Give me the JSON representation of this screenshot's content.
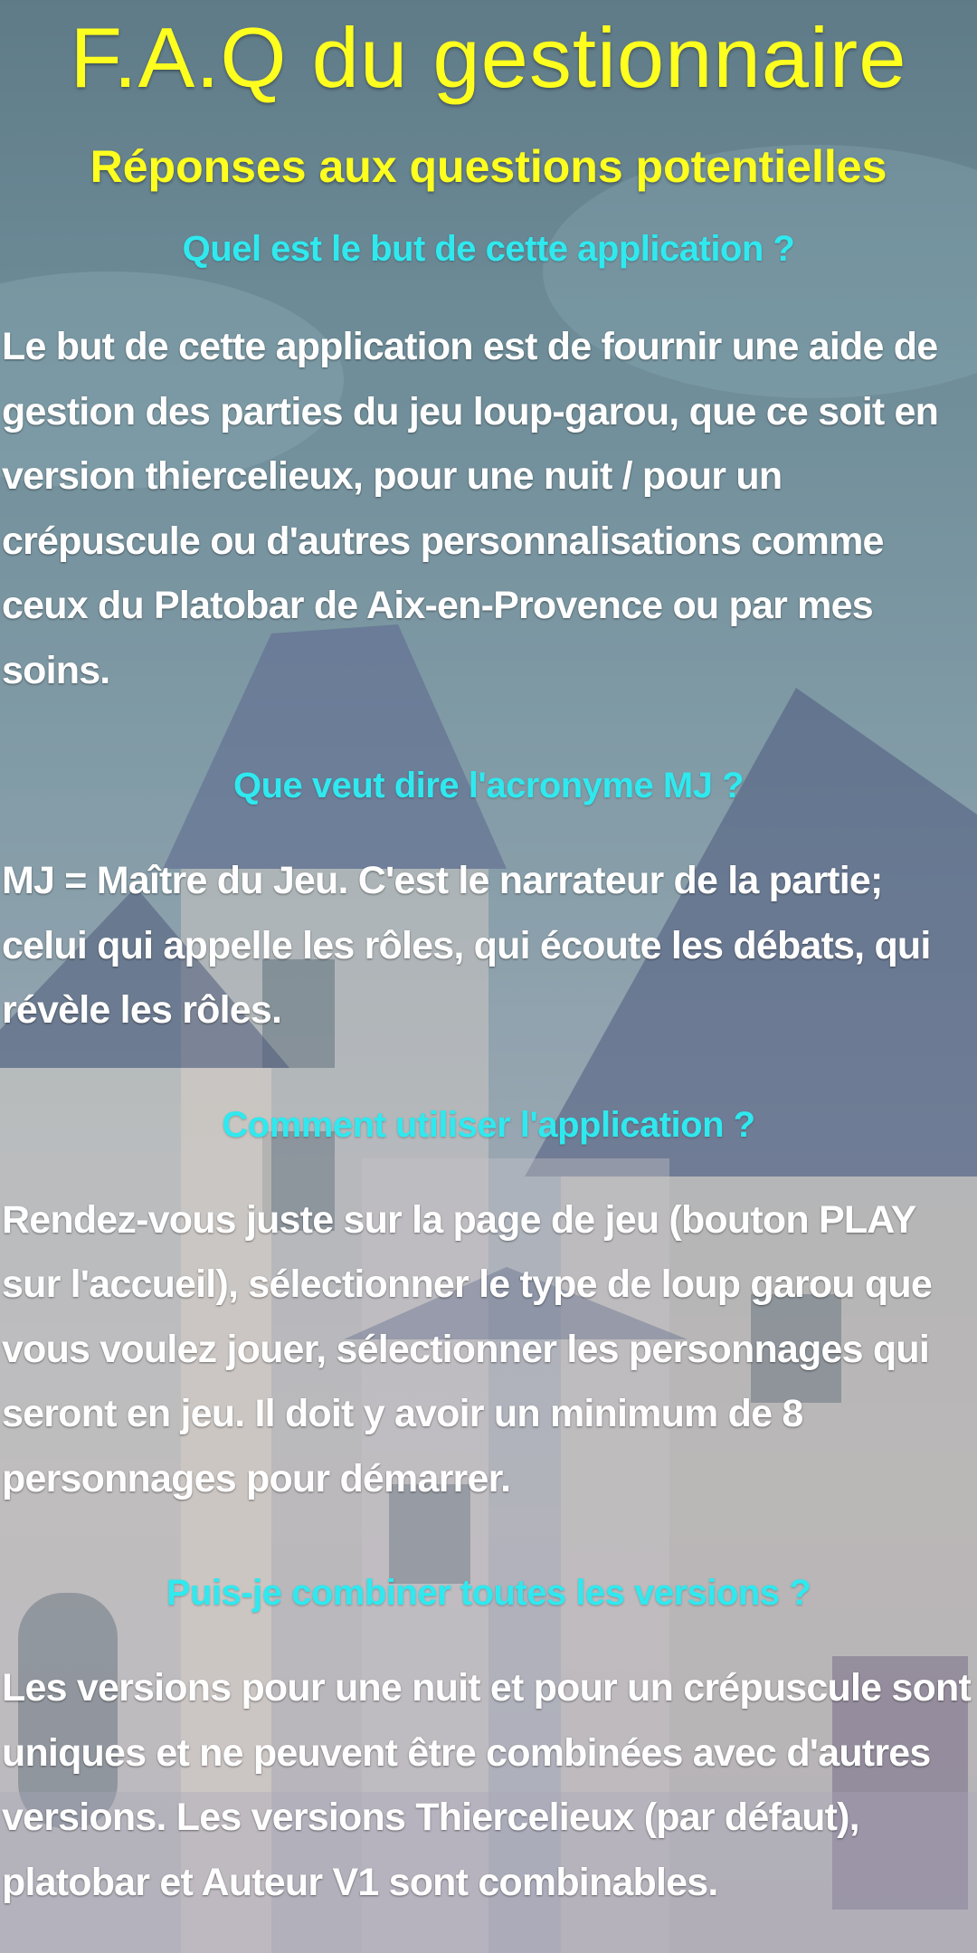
{
  "header": {
    "title": "F.A.Q du gestionnaire",
    "subtitle": "Réponses aux questions potentielles"
  },
  "faq": [
    {
      "question": "Quel est le but de cette application ?",
      "answer": "Le but de cette application est de fournir une aide de gestion des parties du jeu loup-garou, que ce soit en version thiercelieux, pour une nuit / pour un crépuscule ou d'autres personnalisations comme ceux du Platobar de Aix-en-Provence ou par mes soins."
    },
    {
      "question": "Que veut dire l'acronyme MJ ?",
      "answer": "MJ = Maître du Jeu. C'est le narrateur de la partie; celui qui appelle les rôles, qui écoute les débats, qui révèle les rôles."
    },
    {
      "question": "Comment utiliser l'application ?",
      "answer": "Rendez-vous juste sur la page de jeu (bouton PLAY sur l'accueil), sélectionner le type de loup garou que vous voulez jouer, sélectionner les personnages qui seront en jeu. Il doit y avoir un minimum de 8 personnages pour démarrer."
    },
    {
      "question": "Puis-je combiner toutes les versions ?",
      "answer": "Les versions pour une nuit et pour un crépuscule sont uniques et ne peuvent être combinées avec d'autres versions. Les versions Thiercelieux (par défaut), platobar et Auteur V1 sont combinables."
    }
  ],
  "colors": {
    "title": "#ffff1f",
    "question": "#2fe9ef",
    "answer": "#ffffff"
  }
}
